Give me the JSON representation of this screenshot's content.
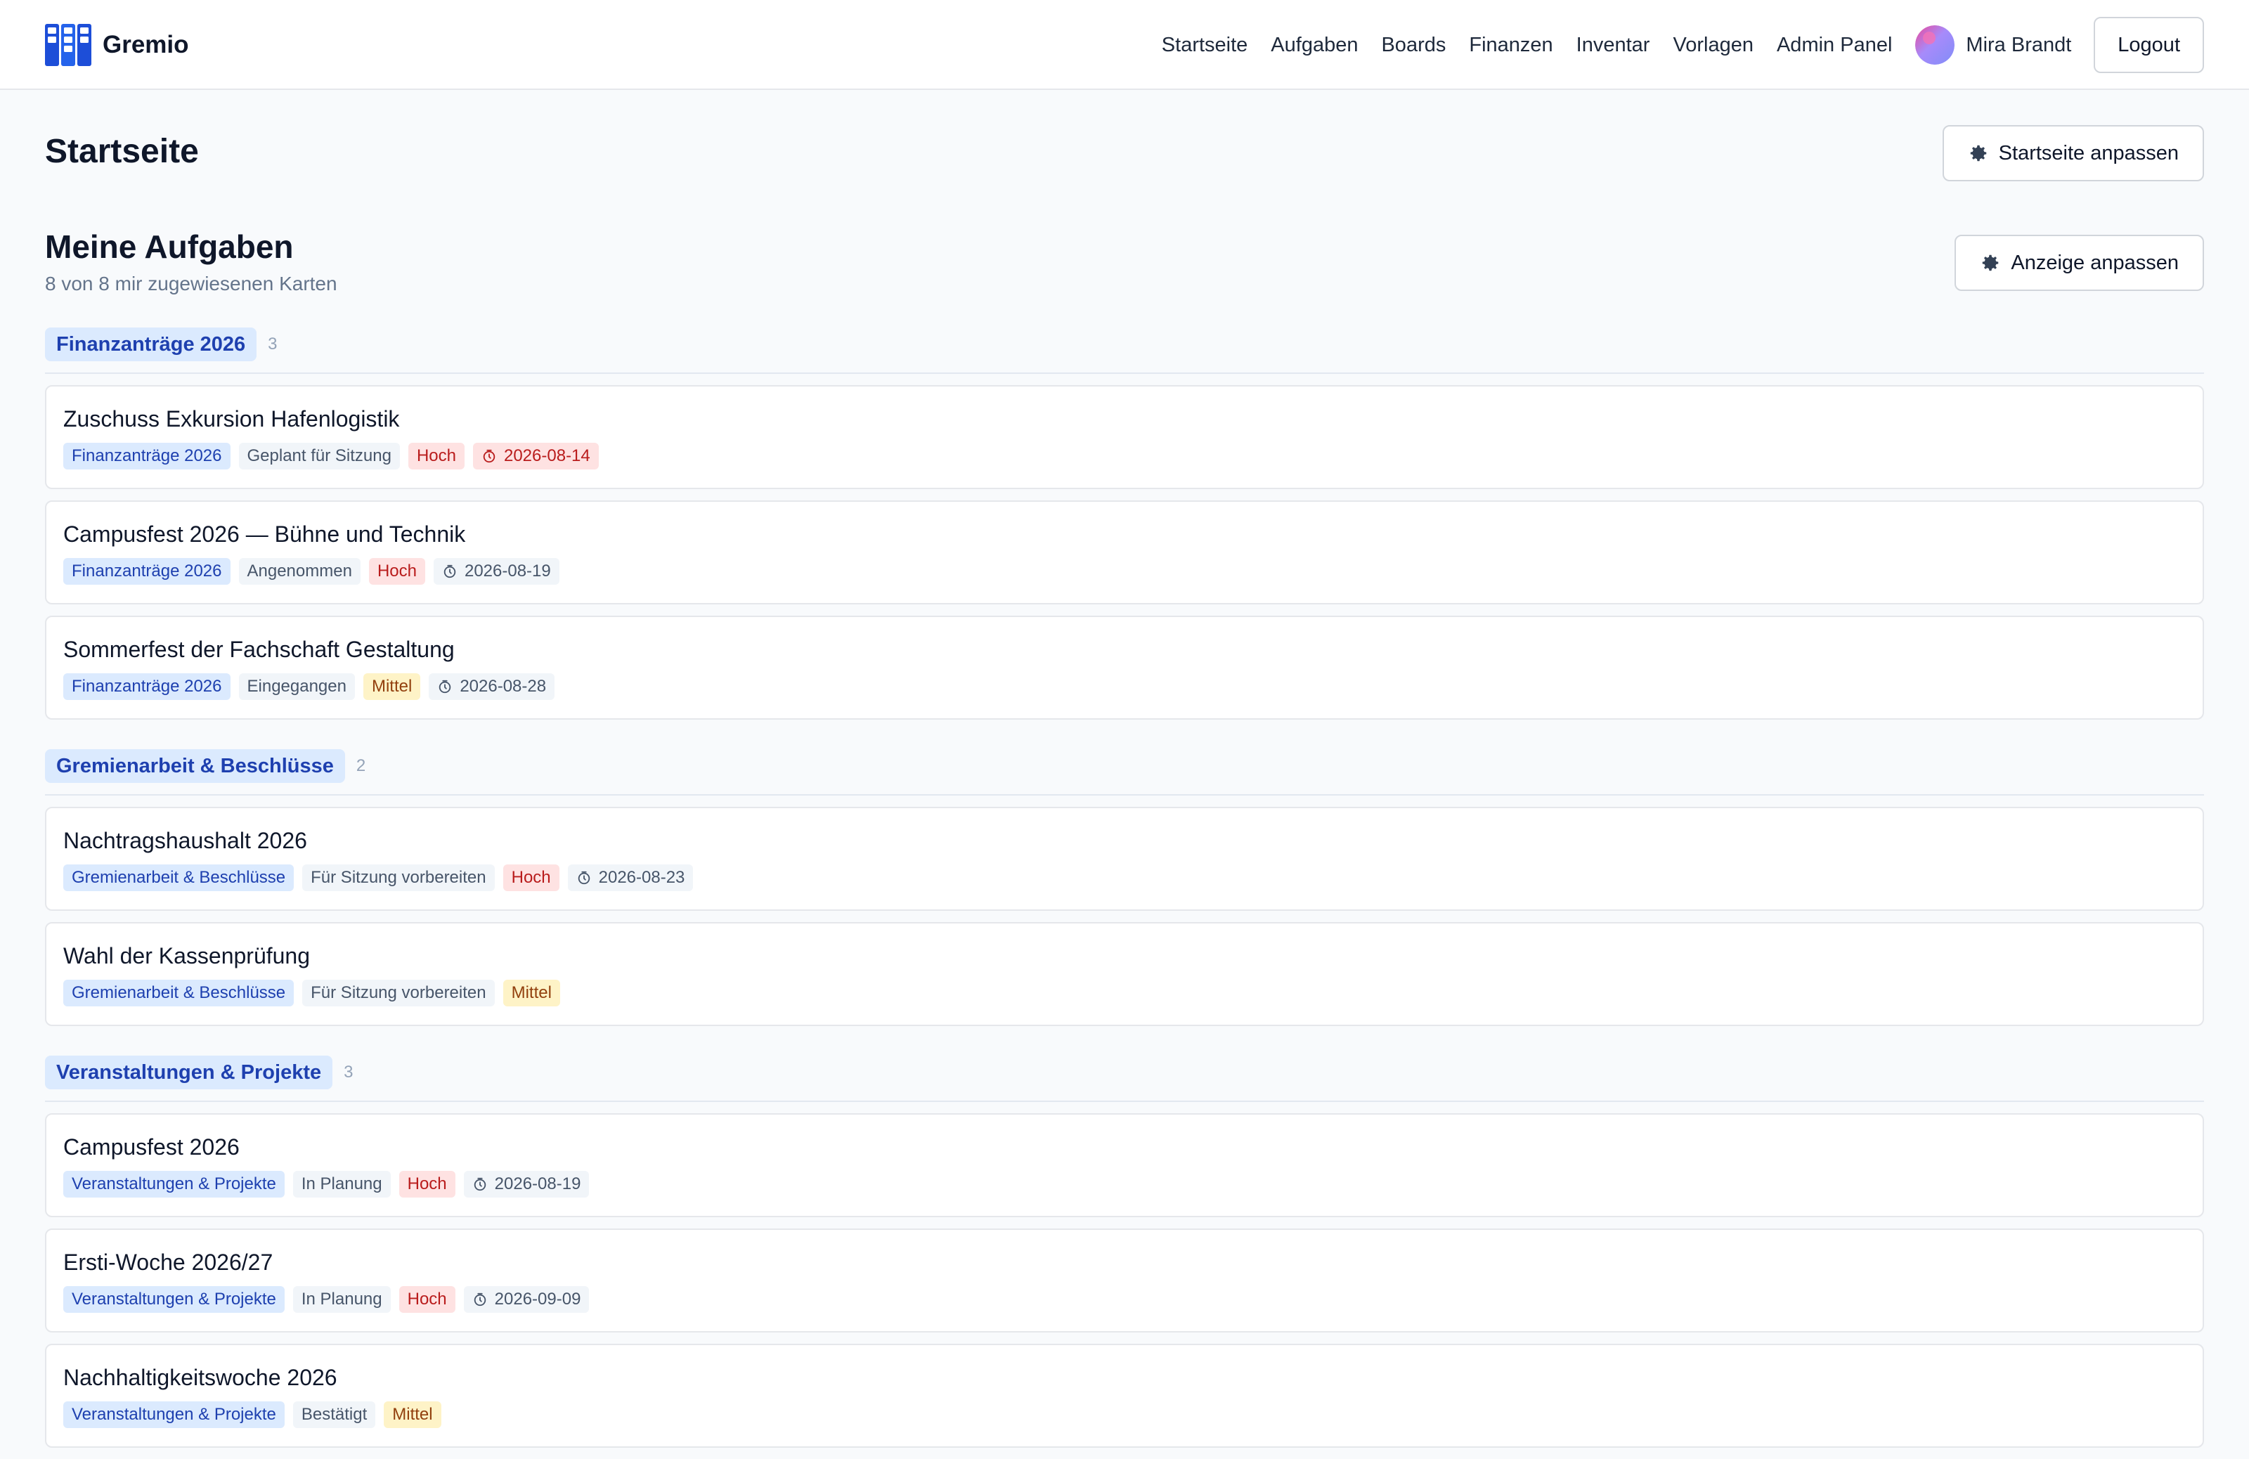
{
  "app": {
    "name": "Gremio",
    "logo_icon": "kanban-board-icon",
    "accent": "#2563eb"
  },
  "nav": {
    "links": [
      "Startseite",
      "Aufgaben",
      "Boards",
      "Finanzen",
      "Inventar",
      "Vorlagen",
      "Admin Panel"
    ],
    "user_name": "Mira Brandt",
    "logout_label": "Logout"
  },
  "page": {
    "title": "Startseite",
    "customize_label": "Startseite anpassen"
  },
  "tasks": {
    "title": "Meine Aufgaben",
    "subtitle": "8 von 8 mir zugewiesenen Karten",
    "view_label": "Anzeige anpassen",
    "groups": [
      {
        "name": "Finanzanträge 2026",
        "count": "3",
        "cards": [
          {
            "title": "Zuschuss Exkursion Hafenlogistik",
            "board": "Finanzanträge 2026",
            "status": "Geplant für Sitzung",
            "priority": "Hoch",
            "priority_level": "hoch",
            "due": "2026-08-14",
            "overdue": true
          },
          {
            "title": "Campusfest 2026 — Bühne und Technik",
            "board": "Finanzanträge 2026",
            "status": "Angenommen",
            "priority": "Hoch",
            "priority_level": "hoch",
            "due": "2026-08-19",
            "overdue": false
          },
          {
            "title": "Sommerfest der Fachschaft Gestaltung",
            "board": "Finanzanträge 2026",
            "status": "Eingegangen",
            "priority": "Mittel",
            "priority_level": "mittel",
            "due": "2026-08-28",
            "overdue": false
          }
        ]
      },
      {
        "name": "Gremienarbeit & Beschlüsse",
        "count": "2",
        "cards": [
          {
            "title": "Nachtragshaushalt 2026",
            "board": "Gremienarbeit & Beschlüsse",
            "status": "Für Sitzung vorbereiten",
            "priority": "Hoch",
            "priority_level": "hoch",
            "due": "2026-08-23",
            "overdue": false
          },
          {
            "title": "Wahl der Kassenprüfung",
            "board": "Gremienarbeit & Beschlüsse",
            "status": "Für Sitzung vorbereiten",
            "priority": "Mittel",
            "priority_level": "mittel",
            "due": null,
            "overdue": false
          }
        ]
      },
      {
        "name": "Veranstaltungen & Projekte",
        "count": "3",
        "cards": [
          {
            "title": "Campusfest 2026",
            "board": "Veranstaltungen & Projekte",
            "status": "In Planung",
            "priority": "Hoch",
            "priority_level": "hoch",
            "due": "2026-08-19",
            "overdue": false
          },
          {
            "title": "Ersti-Woche 2026/27",
            "board": "Veranstaltungen & Projekte",
            "status": "In Planung",
            "priority": "Hoch",
            "priority_level": "hoch",
            "due": "2026-09-09",
            "overdue": false
          },
          {
            "title": "Nachhaltigkeitswoche 2026",
            "board": "Veranstaltungen & Projekte",
            "status": "Bestätigt",
            "priority": "Mittel",
            "priority_level": "mittel",
            "due": null,
            "overdue": false
          }
        ]
      }
    ]
  },
  "icons": {
    "gear": "gear-icon",
    "due": "clock-icon",
    "avatar": "avatar"
  }
}
